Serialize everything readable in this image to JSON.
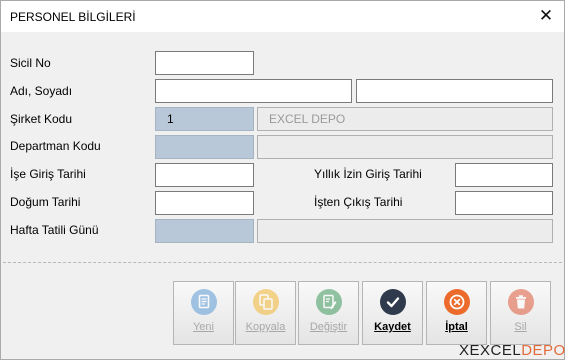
{
  "window": {
    "title": "PERSONEL BİLGİLERİ",
    "close_glyph": "✕"
  },
  "form": {
    "sicil_no": {
      "label": "Sicil No",
      "value": ""
    },
    "adi_soyadi": {
      "label": "Adı, Soyadı",
      "value_first": "",
      "value_last": ""
    },
    "sirket_kodu": {
      "label": "Şirket Kodu",
      "value": "1",
      "name": "EXCEL DEPO"
    },
    "departman_kodu": {
      "label": "Departman Kodu",
      "value": "",
      "name": ""
    },
    "ise_giris_tarihi": {
      "label": "İşe Giriş Tarihi",
      "value": ""
    },
    "yillik_izin_giris_tarihi": {
      "label": "Yıllık İzin Giriş Tarihi",
      "value": ""
    },
    "dogum_tarihi": {
      "label": "Doğum Tarihi",
      "value": ""
    },
    "isten_cikis_tarihi": {
      "label": "İşten Çıkış Tarihi",
      "value": ""
    },
    "hafta_tatili_gunu": {
      "label": "Hafta Tatili Günü",
      "value": "",
      "name": ""
    }
  },
  "buttons": [
    {
      "label": "Yeni",
      "icon": "document-icon",
      "color": "#5b9bd5",
      "enabled": false
    },
    {
      "label": "Kopyala",
      "icon": "copy-icon",
      "color": "#f2b632",
      "enabled": false
    },
    {
      "label": "Değiştir",
      "icon": "edit-icon",
      "color": "#3f9a5e",
      "enabled": false
    },
    {
      "label": "Kaydet",
      "icon": "check-icon",
      "color": "#2f3b4c",
      "enabled": true
    },
    {
      "label": "İptal",
      "icon": "cancel-icon",
      "color": "#ec6a2c",
      "enabled": true
    },
    {
      "label": "Sil",
      "icon": "trash-icon",
      "color": "#e05a3a",
      "enabled": false
    }
  ],
  "brand": {
    "prefix": "X",
    "text": "EXCEL",
    "accent": "DEPO"
  }
}
